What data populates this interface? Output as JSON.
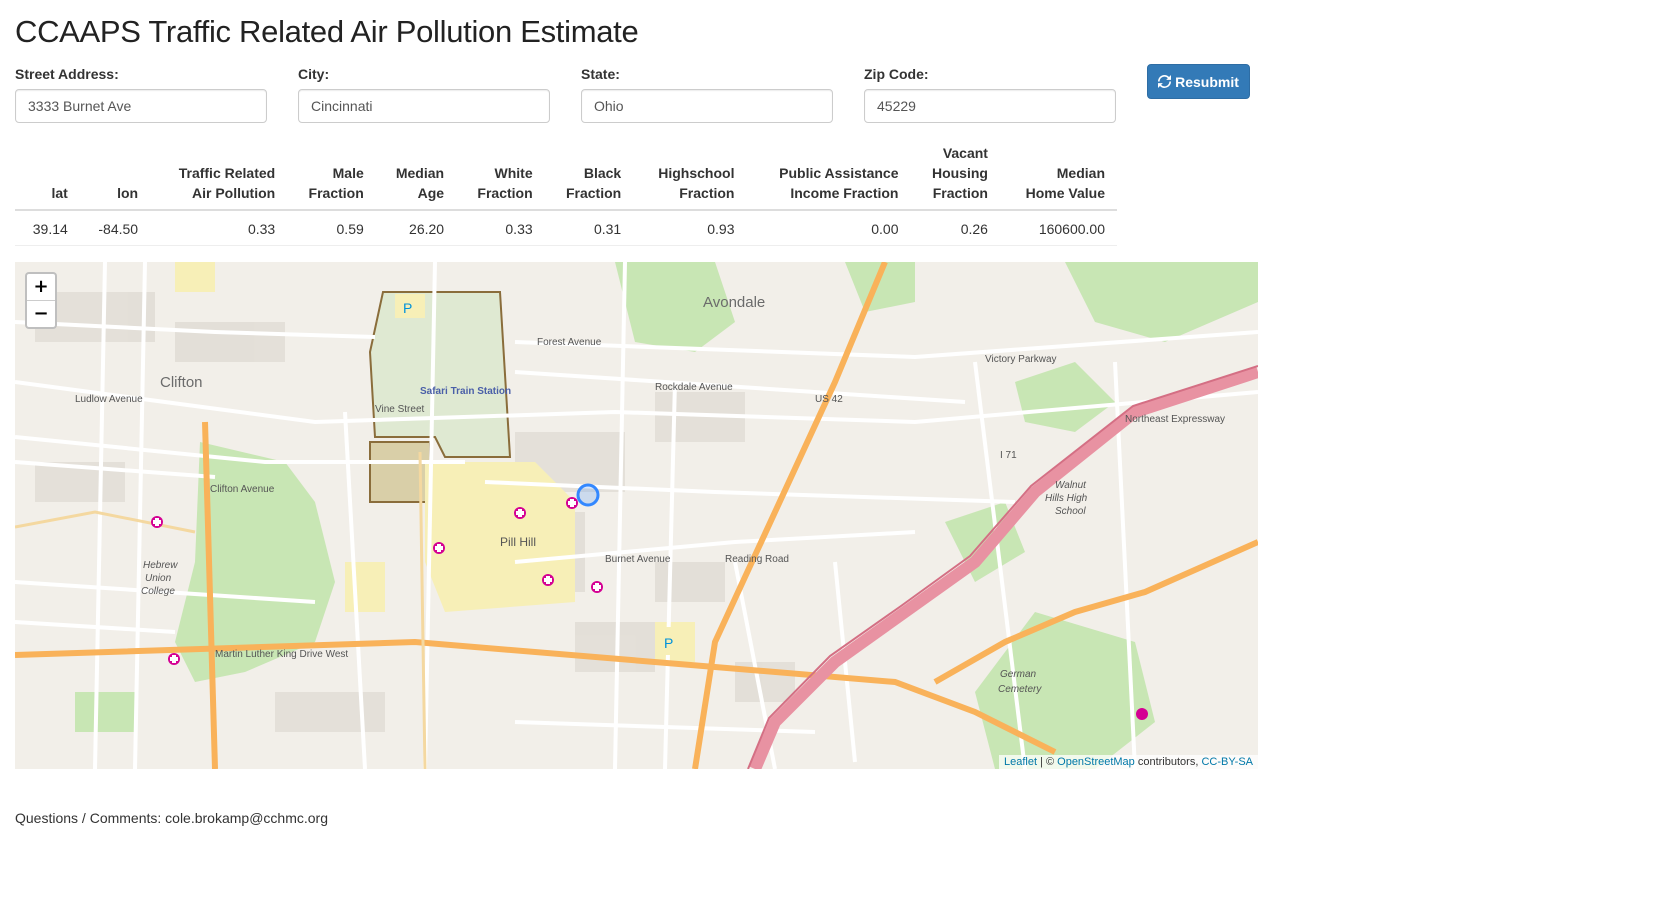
{
  "page": {
    "title": "CCAAPS Traffic Related Air Pollution Estimate"
  },
  "form": {
    "street": {
      "label": "Street Address:",
      "value": "3333 Burnet Ave"
    },
    "city": {
      "label": "City:",
      "value": "Cincinnati"
    },
    "state": {
      "label": "State:",
      "value": "Ohio"
    },
    "zip": {
      "label": "Zip Code:",
      "value": "45229"
    },
    "resubmit_label": "Resubmit",
    "resubmit_icon": "refresh-icon"
  },
  "results": {
    "headers": {
      "lat": [
        "",
        "",
        "lat"
      ],
      "lon": [
        "",
        "",
        "lon"
      ],
      "trap": [
        "",
        "Traffic Related",
        "Air Pollution"
      ],
      "male": [
        "",
        "Male",
        "Fraction"
      ],
      "age": [
        "",
        "Median",
        "Age"
      ],
      "white": [
        "",
        "White",
        "Fraction"
      ],
      "black": [
        "",
        "Black",
        "Fraction"
      ],
      "hs": [
        "",
        "Highschool",
        "Fraction"
      ],
      "pai": [
        "",
        "Public Assistance",
        "Income Fraction"
      ],
      "vac": [
        "Vacant",
        "Housing",
        "Fraction"
      ],
      "home": [
        "",
        "Median",
        "Home Value"
      ]
    },
    "row": {
      "lat": "39.14",
      "lon": "-84.50",
      "trap": "0.33",
      "male": "0.59",
      "age": "26.20",
      "white": "0.33",
      "black": "0.31",
      "hs": "0.93",
      "pai": "0.00",
      "vac": "0.26",
      "home": "160600.00"
    }
  },
  "map": {
    "zoom_in": "+",
    "zoom_out": "−",
    "attribution": {
      "leaflet": "Leaflet",
      "sep": " | © ",
      "osm": "OpenStreetMap",
      "contrib": " contributors, ",
      "license": "CC-BY-SA"
    },
    "labels": {
      "clifton": "Clifton",
      "avondale": "Avondale",
      "pill_hill": "Pill Hill",
      "safari": "Safari Train Station",
      "forest": "Forest Avenue",
      "mlk": "Martin Luther King Drive West",
      "us42": "US 42",
      "i71": "I 71",
      "northeast": "Northeast Expressway",
      "reading": "Reading Road",
      "burnet": "Burnet Avenue",
      "vine": "Vine Street",
      "clifton_ave": "Clifton Avenue",
      "german": "German",
      "cemetery": "Cemetery",
      "hebrew": "Hebrew",
      "union": "Union",
      "college": "College",
      "walnut": "Walnut",
      "hills": "Hills High",
      "school": "School",
      "ludlow": "Ludlow Avenue",
      "rockdale": "Rockdale Avenue",
      "victory": "Victory Parkway",
      "parking": "P"
    },
    "colors": {
      "land": "#f2efe9",
      "park": "#b8dca8",
      "motorway": "#e892a2",
      "trunk": "#f9b25a",
      "hospital": "#d40093",
      "marker": "#3388ff"
    }
  },
  "footer": {
    "text": "Questions / Comments: cole.brokamp@cchmc.org"
  }
}
